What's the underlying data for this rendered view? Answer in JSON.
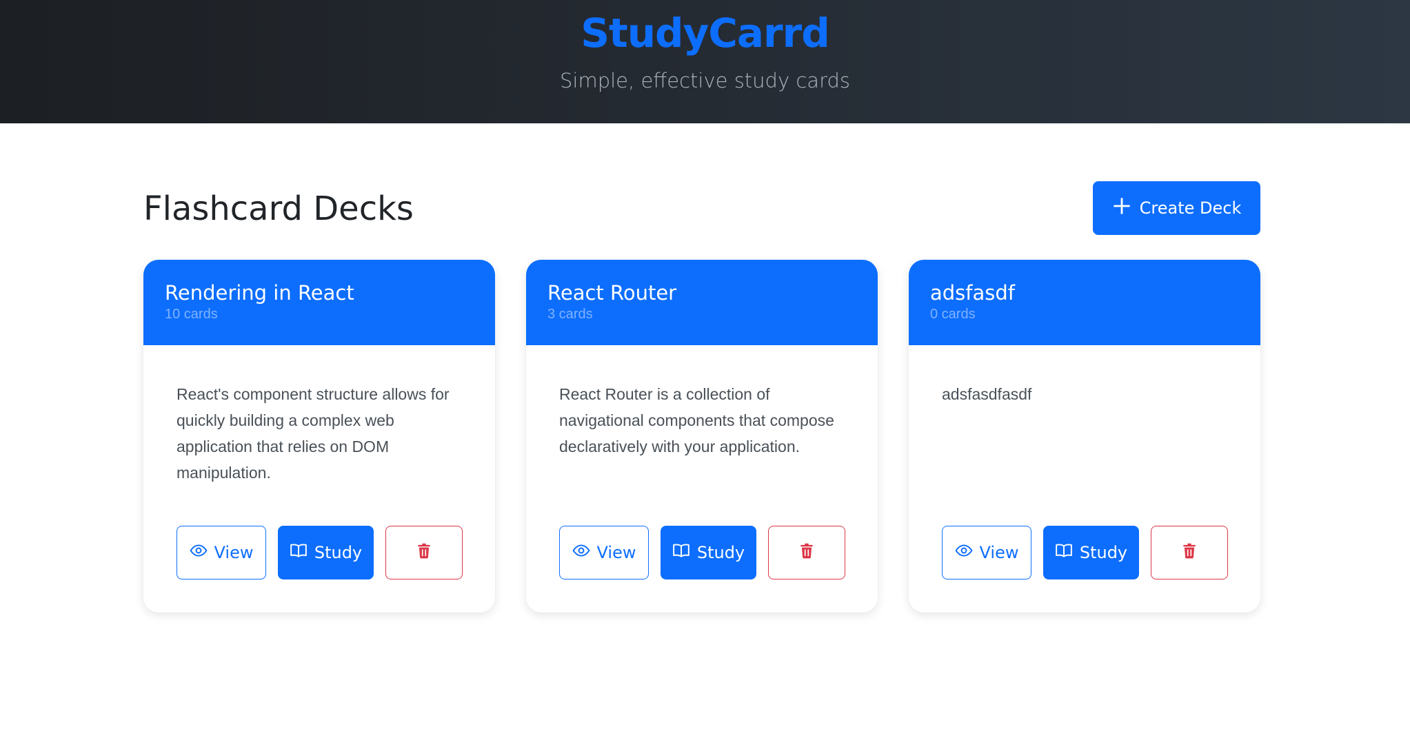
{
  "app": {
    "brand": "StudyCarrd",
    "tagline": "Simple, effective study cards"
  },
  "page": {
    "title": "Flashcard Decks",
    "create_label": "Create Deck"
  },
  "decks": [
    {
      "name": "Rendering in React",
      "count": "10 cards",
      "description": "React's component structure allows for quickly building a complex web application that relies on DOM manipulation.",
      "view_label": "View",
      "study_label": "Study"
    },
    {
      "name": "React Router",
      "count": "3 cards",
      "description": "React Router is a collection of navigational components that compose declaratively with your application.",
      "view_label": "View",
      "study_label": "Study"
    },
    {
      "name": "adsfasdf",
      "count": "0 cards",
      "description": "adsfasdfasdf",
      "view_label": "View",
      "study_label": "Study"
    }
  ],
  "icons": {
    "create": "plus-icon",
    "view": "eye-icon",
    "study": "book-icon",
    "delete": "trash-icon"
  },
  "colors": {
    "primary": "#0d6efd",
    "danger": "#dc3545",
    "header_dark": "#212529"
  }
}
